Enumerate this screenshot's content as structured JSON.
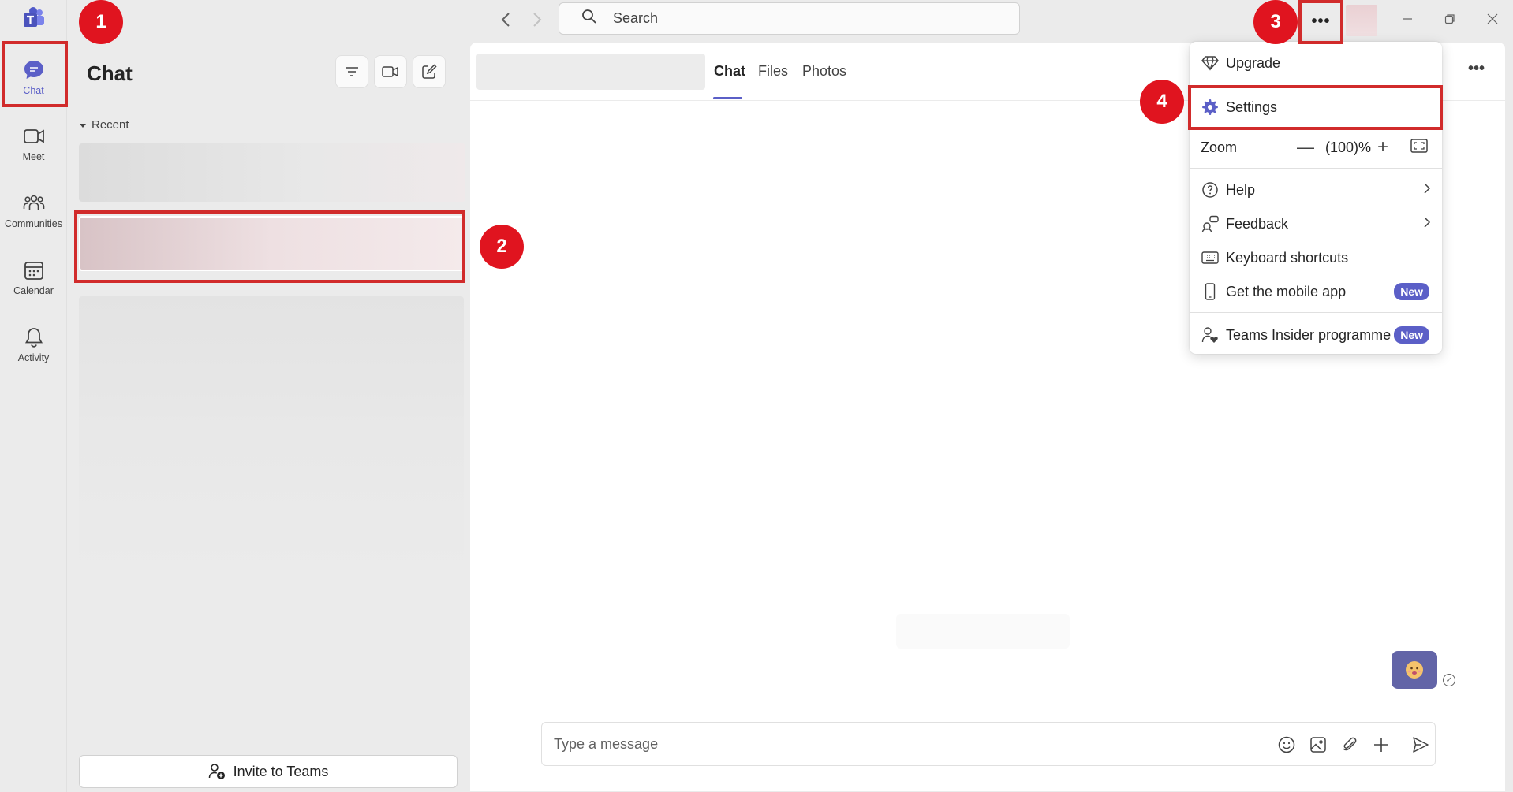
{
  "titlebar": {
    "search_placeholder": "Search",
    "more_label": "•••"
  },
  "rail": {
    "items": [
      {
        "label": "Chat"
      },
      {
        "label": "Meet"
      },
      {
        "label": "Communities"
      },
      {
        "label": "Calendar"
      },
      {
        "label": "Activity"
      }
    ]
  },
  "chatlist": {
    "title": "Chat",
    "recent_label": "Recent",
    "invite_label": "Invite to Teams"
  },
  "main": {
    "tabs": [
      {
        "label": "Chat"
      },
      {
        "label": "Files"
      },
      {
        "label": "Photos"
      }
    ],
    "more_label": "•••",
    "composer_placeholder": "Type a message"
  },
  "menu": {
    "upgrade": "Upgrade",
    "settings": "Settings",
    "zoom_label": "Zoom",
    "zoom_value": "(100)%",
    "zoom_minus": "—",
    "zoom_plus": "+",
    "help": "Help",
    "feedback": "Feedback",
    "keyboard_shortcuts": "Keyboard shortcuts",
    "mobile_app": "Get the mobile app",
    "insider": "Teams Insider programme",
    "new_badge": "New"
  },
  "annotations": {
    "step1": "1",
    "step2": "2",
    "step3": "3",
    "step4": "4"
  },
  "colors": {
    "accent": "#5b5fc7",
    "annotation_red": "#d12b2b",
    "step_red": "#e0141f"
  }
}
